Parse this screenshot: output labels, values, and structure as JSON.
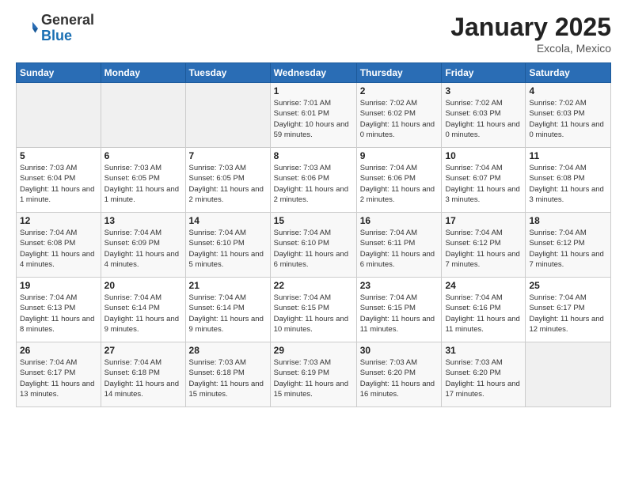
{
  "header": {
    "logo_general": "General",
    "logo_blue": "Blue",
    "month": "January 2025",
    "location": "Excola, Mexico"
  },
  "weekdays": [
    "Sunday",
    "Monday",
    "Tuesday",
    "Wednesday",
    "Thursday",
    "Friday",
    "Saturday"
  ],
  "weeks": [
    [
      {
        "day": "",
        "info": ""
      },
      {
        "day": "",
        "info": ""
      },
      {
        "day": "",
        "info": ""
      },
      {
        "day": "1",
        "info": "Sunrise: 7:01 AM\nSunset: 6:01 PM\nDaylight: 10 hours\nand 59 minutes."
      },
      {
        "day": "2",
        "info": "Sunrise: 7:02 AM\nSunset: 6:02 PM\nDaylight: 11 hours\nand 0 minutes."
      },
      {
        "day": "3",
        "info": "Sunrise: 7:02 AM\nSunset: 6:03 PM\nDaylight: 11 hours\nand 0 minutes."
      },
      {
        "day": "4",
        "info": "Sunrise: 7:02 AM\nSunset: 6:03 PM\nDaylight: 11 hours\nand 0 minutes."
      }
    ],
    [
      {
        "day": "5",
        "info": "Sunrise: 7:03 AM\nSunset: 6:04 PM\nDaylight: 11 hours\nand 1 minute."
      },
      {
        "day": "6",
        "info": "Sunrise: 7:03 AM\nSunset: 6:05 PM\nDaylight: 11 hours\nand 1 minute."
      },
      {
        "day": "7",
        "info": "Sunrise: 7:03 AM\nSunset: 6:05 PM\nDaylight: 11 hours\nand 2 minutes."
      },
      {
        "day": "8",
        "info": "Sunrise: 7:03 AM\nSunset: 6:06 PM\nDaylight: 11 hours\nand 2 minutes."
      },
      {
        "day": "9",
        "info": "Sunrise: 7:04 AM\nSunset: 6:06 PM\nDaylight: 11 hours\nand 2 minutes."
      },
      {
        "day": "10",
        "info": "Sunrise: 7:04 AM\nSunset: 6:07 PM\nDaylight: 11 hours\nand 3 minutes."
      },
      {
        "day": "11",
        "info": "Sunrise: 7:04 AM\nSunset: 6:08 PM\nDaylight: 11 hours\nand 3 minutes."
      }
    ],
    [
      {
        "day": "12",
        "info": "Sunrise: 7:04 AM\nSunset: 6:08 PM\nDaylight: 11 hours\nand 4 minutes."
      },
      {
        "day": "13",
        "info": "Sunrise: 7:04 AM\nSunset: 6:09 PM\nDaylight: 11 hours\nand 4 minutes."
      },
      {
        "day": "14",
        "info": "Sunrise: 7:04 AM\nSunset: 6:10 PM\nDaylight: 11 hours\nand 5 minutes."
      },
      {
        "day": "15",
        "info": "Sunrise: 7:04 AM\nSunset: 6:10 PM\nDaylight: 11 hours\nand 6 minutes."
      },
      {
        "day": "16",
        "info": "Sunrise: 7:04 AM\nSunset: 6:11 PM\nDaylight: 11 hours\nand 6 minutes."
      },
      {
        "day": "17",
        "info": "Sunrise: 7:04 AM\nSunset: 6:12 PM\nDaylight: 11 hours\nand 7 minutes."
      },
      {
        "day": "18",
        "info": "Sunrise: 7:04 AM\nSunset: 6:12 PM\nDaylight: 11 hours\nand 7 minutes."
      }
    ],
    [
      {
        "day": "19",
        "info": "Sunrise: 7:04 AM\nSunset: 6:13 PM\nDaylight: 11 hours\nand 8 minutes."
      },
      {
        "day": "20",
        "info": "Sunrise: 7:04 AM\nSunset: 6:14 PM\nDaylight: 11 hours\nand 9 minutes."
      },
      {
        "day": "21",
        "info": "Sunrise: 7:04 AM\nSunset: 6:14 PM\nDaylight: 11 hours\nand 9 minutes."
      },
      {
        "day": "22",
        "info": "Sunrise: 7:04 AM\nSunset: 6:15 PM\nDaylight: 11 hours\nand 10 minutes."
      },
      {
        "day": "23",
        "info": "Sunrise: 7:04 AM\nSunset: 6:15 PM\nDaylight: 11 hours\nand 11 minutes."
      },
      {
        "day": "24",
        "info": "Sunrise: 7:04 AM\nSunset: 6:16 PM\nDaylight: 11 hours\nand 11 minutes."
      },
      {
        "day": "25",
        "info": "Sunrise: 7:04 AM\nSunset: 6:17 PM\nDaylight: 11 hours\nand 12 minutes."
      }
    ],
    [
      {
        "day": "26",
        "info": "Sunrise: 7:04 AM\nSunset: 6:17 PM\nDaylight: 11 hours\nand 13 minutes."
      },
      {
        "day": "27",
        "info": "Sunrise: 7:04 AM\nSunset: 6:18 PM\nDaylight: 11 hours\nand 14 minutes."
      },
      {
        "day": "28",
        "info": "Sunrise: 7:03 AM\nSunset: 6:18 PM\nDaylight: 11 hours\nand 15 minutes."
      },
      {
        "day": "29",
        "info": "Sunrise: 7:03 AM\nSunset: 6:19 PM\nDaylight: 11 hours\nand 15 minutes."
      },
      {
        "day": "30",
        "info": "Sunrise: 7:03 AM\nSunset: 6:20 PM\nDaylight: 11 hours\nand 16 minutes."
      },
      {
        "day": "31",
        "info": "Sunrise: 7:03 AM\nSunset: 6:20 PM\nDaylight: 11 hours\nand 17 minutes."
      },
      {
        "day": "",
        "info": ""
      }
    ]
  ]
}
